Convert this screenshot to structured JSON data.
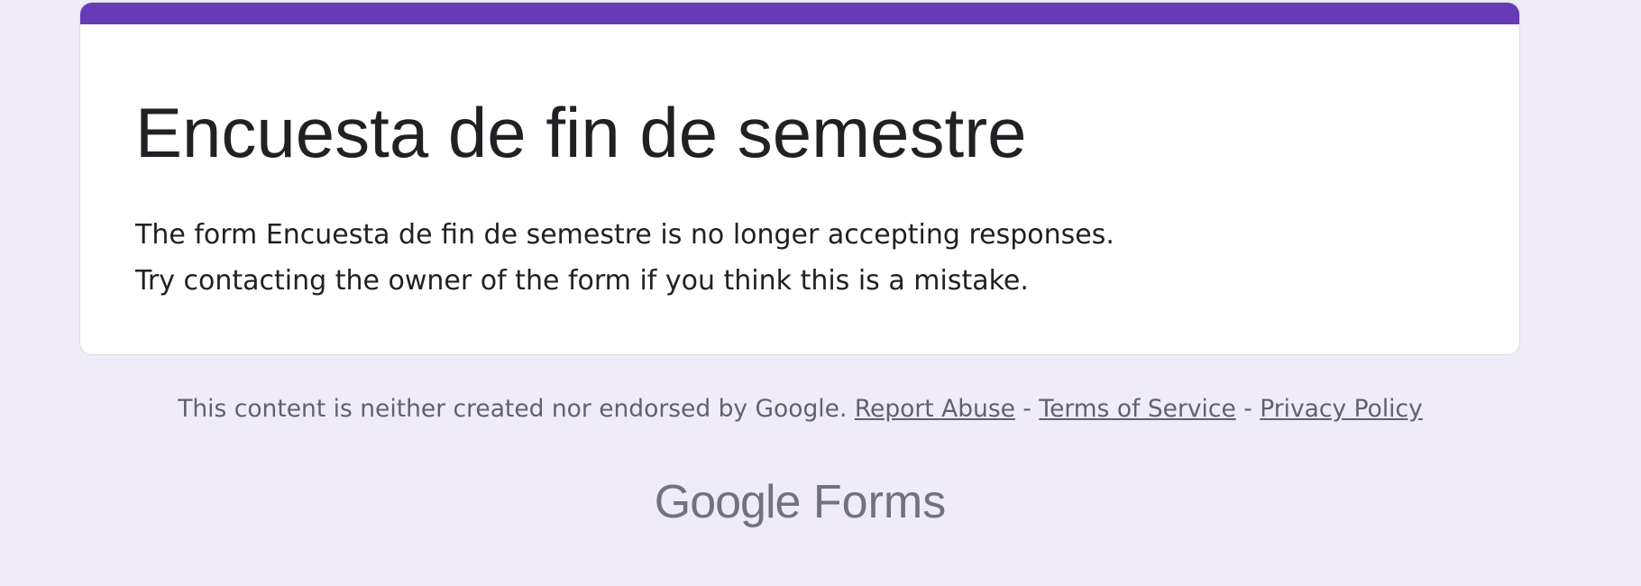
{
  "form": {
    "title": "Encuesta de fin de semestre",
    "message_line1": "The form Encuesta de fin de semestre is no longer accepting responses.",
    "message_line2": "Try contacting the owner of the form if you think this is a mistake."
  },
  "footer": {
    "disclaimer": "This content is neither created nor endorsed by Google.",
    "separator": "-",
    "links": {
      "report_abuse": "Report Abuse",
      "terms": "Terms of Service",
      "privacy": "Privacy Policy"
    }
  },
  "brand": {
    "google": "Google",
    "product": "Forms"
  },
  "colors": {
    "accent": "#673ab7",
    "background": "#f0ebf8",
    "card": "#ffffff"
  }
}
